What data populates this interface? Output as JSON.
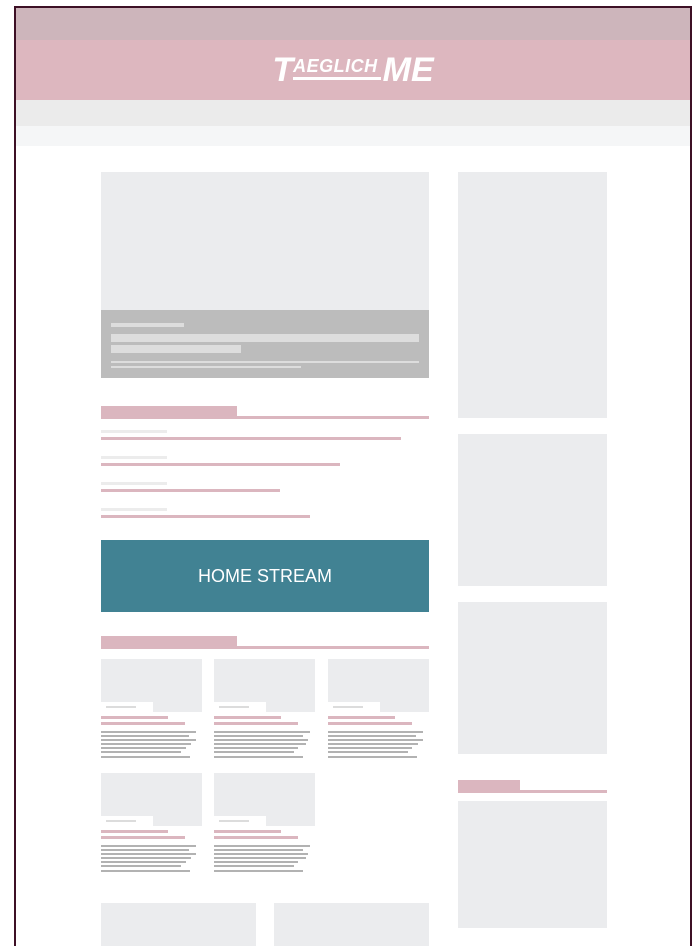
{
  "header": {
    "logo_t": "T",
    "logo_mid": "AEGLICH",
    "logo_me": "ME"
  },
  "stream_button": {
    "label": "HOME STREAM"
  }
}
